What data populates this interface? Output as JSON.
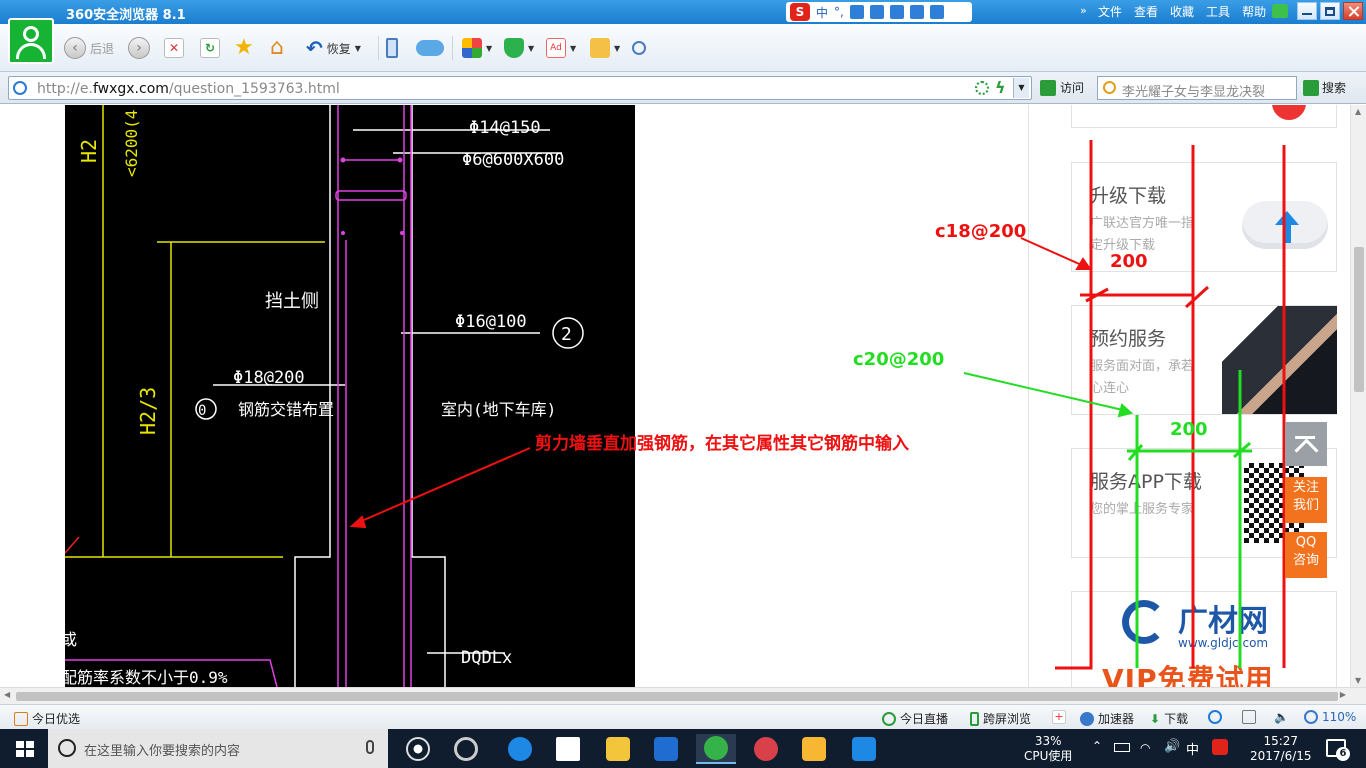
{
  "window": {
    "title": "360安全浏览器 8.1",
    "menu": [
      "文件",
      "查看",
      "收藏",
      "工具",
      "帮助"
    ]
  },
  "ime": {
    "lang": "中",
    "punct": "°,"
  },
  "toolbar": {
    "back_label": "后退",
    "restore_label": "恢复"
  },
  "address": {
    "url_prefix": "http://e.",
    "url_domain": "fwxgx.com",
    "url_path": "/question_1593763.html",
    "visit_label": "访问",
    "search_value": "李光耀子女与李显龙决裂",
    "search_label": "搜索"
  },
  "sidebar": {
    "cards": [
      {
        "title": "升级下载",
        "desc": "广联达官方唯一指定升级下载"
      },
      {
        "title": "预约服务",
        "desc": "服务面对面，承若心连心"
      },
      {
        "title": "服务APP下载",
        "desc": "您的掌上服务专家"
      }
    ],
    "brand_cn": "广材网",
    "brand_url": "www.gldjc.com",
    "vip_text": "VIP免费试用",
    "follow_label": [
      "关注",
      "我们"
    ],
    "qq_label": [
      "QQ",
      "咨询"
    ]
  },
  "cad": {
    "h2": "H2",
    "dim_text": "<6200(4",
    "h23": "H2/3",
    "rebar_top1": "Φ14@150",
    "rebar_top2": "Φ6@600X600",
    "soil_side": "挡土侧",
    "rebar_mid": "Φ16@100",
    "circle_num": "2",
    "rebar_left": "Φ18@200",
    "stagger": "钢筋交错布置",
    "circle_left": "0",
    "indoor": "室内(地下车库)",
    "dqdl": "DQDLx",
    "bottom_text": "配筋率系数不小于0.9%",
    "corner_text": "或"
  },
  "annotations": {
    "red_main": "剪力墙垂直加强钢筋，在其它属性其它钢筋中输入",
    "c18": "c18@200",
    "red_200": "200",
    "c20": "c20@200",
    "green_200": "200"
  },
  "statusbar": {
    "left_label": "今日优选",
    "items": [
      "今日直播",
      "跨屏浏览",
      "加速器",
      "下载"
    ],
    "zoom": "110%"
  },
  "taskbar": {
    "search_placeholder": "在这里输入你要搜索的内容",
    "cpu_pct": "33%",
    "cpu_label": "CPU使用",
    "ime_lang": "中",
    "time": "15:27",
    "date": "2017/6/15",
    "notif_count": "6"
  },
  "colors": {
    "title_bar": "#1b7dcf",
    "annotation_red": "#ee1111",
    "annotation_green": "#22dd22",
    "cad_yellow": "#e6e600",
    "cad_magenta": "#e040e0",
    "float_orange": "#f2721e"
  }
}
